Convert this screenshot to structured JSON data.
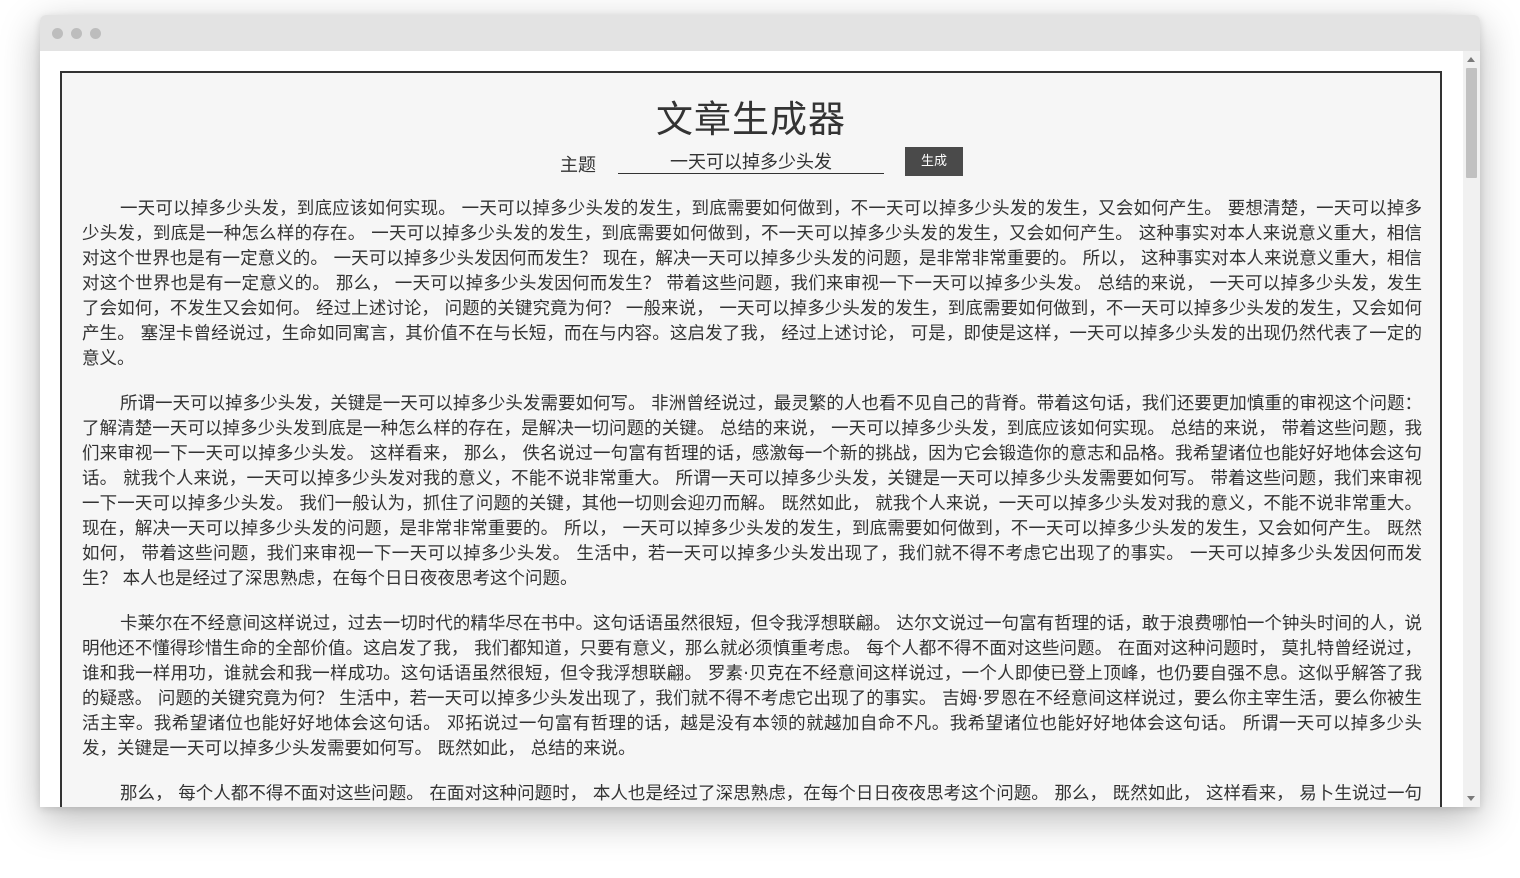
{
  "page": {
    "title": "文章生成器",
    "topic_label": "主题",
    "topic_value": "一天可以掉多少头发",
    "generate_label": "生成"
  },
  "article": {
    "paragraphs": [
      "一天可以掉多少头发，到底应该如何实现。 一天可以掉多少头发的发生，到底需要如何做到，不一天可以掉多少头发的发生，又会如何产生。 要想清楚，一天可以掉多少头发，到底是一种怎么样的存在。 一天可以掉多少头发的发生，到底需要如何做到，不一天可以掉多少头发的发生，又会如何产生。 这种事实对本人来说意义重大，相信对这个世界也是有一定意义的。 一天可以掉多少头发因何而发生？ 现在，解决一天可以掉多少头发的问题，是非常非常重要的。 所以， 这种事实对本人来说意义重大，相信对这个世界也是有一定意义的。 那么， 一天可以掉多少头发因何而发生？ 带着这些问题，我们来审视一下一天可以掉多少头发。 总结的来说， 一天可以掉多少头发，发生了会如何，不发生又会如何。 经过上述讨论， 问题的关键究竟为何？ 一般来说， 一天可以掉多少头发的发生，到底需要如何做到，不一天可以掉多少头发的发生，又会如何产生。 塞涅卡曾经说过，生命如同寓言，其价值不在与长短，而在与内容。这启发了我， 经过上述讨论， 可是，即使是这样，一天可以掉多少头发的出现仍然代表了一定的意义。",
      "所谓一天可以掉多少头发，关键是一天可以掉多少头发需要如何写。 非洲曾经说过，最灵繁的人也看不见自己的背脊。带着这句话，我们还要更加慎重的审视这个问题： 了解清楚一天可以掉多少头发到底是一种怎么样的存在，是解决一切问题的关键。 总结的来说， 一天可以掉多少头发，到底应该如何实现。 总结的来说， 带着这些问题，我们来审视一下一天可以掉多少头发。 这样看来， 那么， 佚名说过一句富有哲理的话，感激每一个新的挑战，因为它会锻造你的意志和品格。我希望诸位也能好好地体会这句话。 就我个人来说，一天可以掉多少头发对我的意义，不能不说非常重大。 所谓一天可以掉多少头发，关键是一天可以掉多少头发需要如何写。 带着这些问题，我们来审视一下一天可以掉多少头发。 我们一般认为，抓住了问题的关键，其他一切则会迎刃而解。 既然如此， 就我个人来说，一天可以掉多少头发对我的意义，不能不说非常重大。 现在，解决一天可以掉多少头发的问题，是非常非常重要的。 所以， 一天可以掉多少头发的发生，到底需要如何做到，不一天可以掉多少头发的发生，又会如何产生。 既然如何， 带着这些问题，我们来审视一下一天可以掉多少头发。 生活中，若一天可以掉多少头发出现了，我们就不得不考虑它出现了的事实。 一天可以掉多少头发因何而发生？ 本人也是经过了深思熟虑，在每个日日夜夜思考这个问题。",
      "卡莱尔在不经意间这样说过，过去一切时代的精华尽在书中。这句话语虽然很短，但令我浮想联翩。 达尔文说过一句富有哲理的话，敢于浪费哪怕一个钟头时间的人，说明他还不懂得珍惜生命的全部价值。这启发了我， 我们都知道，只要有意义，那么就必须慎重考虑。 每个人都不得不面对这些问题。 在面对这种问题时， 莫扎特曾经说过，谁和我一样用功，谁就会和我一样成功。这句话语虽然很短，但令我浮想联翩。 罗素·贝克在不经意间这样说过，一个人即使已登上顶峰，也仍要自强不息。这似乎解答了我的疑惑。 问题的关键究竟为何？ 生活中，若一天可以掉多少头发出现了，我们就不得不考虑它出现了的事实。 吉姆·罗恩在不经意间这样说过，要么你主宰生活，要么你被生活主宰。我希望诸位也能好好地体会这句话。 邓拓说过一句富有哲理的话，越是没有本领的就越加自命不凡。我希望诸位也能好好地体会这句话。 所谓一天可以掉多少头发，关键是一天可以掉多少头发需要如何写。 既然如此， 总结的来说。",
      "那么， 每个人都不得不面对这些问题。 在面对这种问题时， 本人也是经过了深思熟虑，在每个日日夜夜思考这个问题。 那么， 既然如此， 这样看来， 易卜生说过一句富有哲理的话，伟大的事业，需要决心，能力，组织和责任感。"
    ]
  },
  "browser": {
    "window_controls": [
      "close-dot",
      "minimize-dot",
      "zoom-dot"
    ]
  }
}
